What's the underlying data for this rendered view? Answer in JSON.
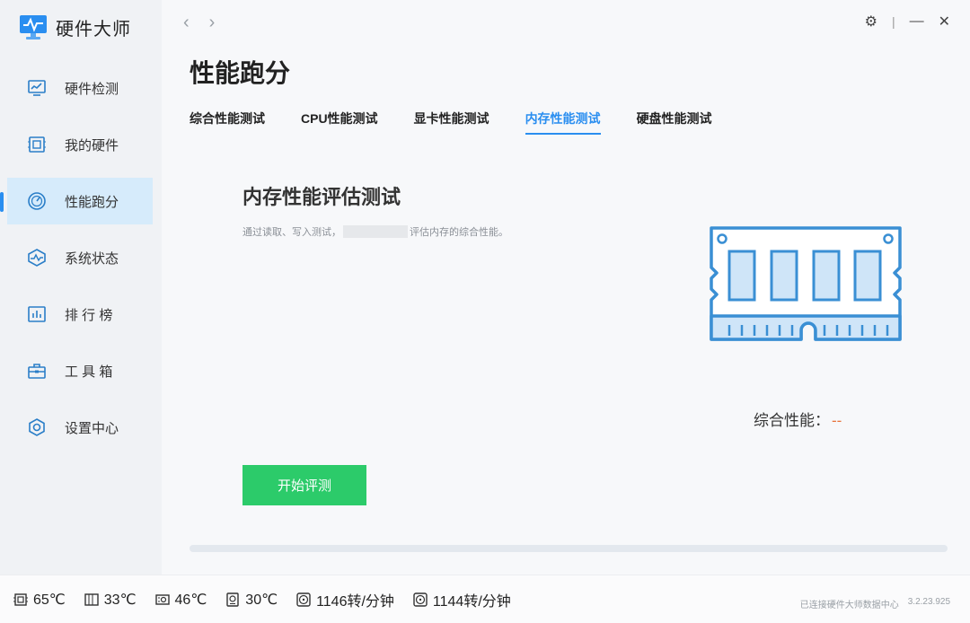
{
  "app": {
    "name": "硬件大师"
  },
  "sidebar": {
    "items": [
      {
        "label": "硬件检测",
        "icon": "monitor-chart-icon"
      },
      {
        "label": "我的硬件",
        "icon": "chip-board-icon"
      },
      {
        "label": "性能跑分",
        "icon": "speedometer-icon",
        "active": true
      },
      {
        "label": "系统状态",
        "icon": "pulse-icon"
      },
      {
        "label": "排 行 榜",
        "icon": "bar-ranking-icon"
      },
      {
        "label": "工 具 箱",
        "icon": "toolbox-icon"
      },
      {
        "label": "设置中心",
        "icon": "hex-settings-icon"
      }
    ]
  },
  "topbar": {
    "back": "‹",
    "forward": "›",
    "settings": "⚙",
    "separator": "|",
    "minimize": "—",
    "close": "✕"
  },
  "page": {
    "title": "性能跑分",
    "tabs": [
      {
        "label": "综合性能测试"
      },
      {
        "label": "CPU性能测试"
      },
      {
        "label": "显卡性能测试"
      },
      {
        "label": "内存性能测试",
        "active": true
      },
      {
        "label": "硬盘性能测试"
      }
    ]
  },
  "test": {
    "title": "内存性能评估测试",
    "desc_prefix": "通过读取、写入测试，",
    "desc_suffix": "评估内存的综合性能。",
    "score_label": "综合性能：",
    "score_value": "--",
    "start_label": "开始评测",
    "progress": 0
  },
  "status": {
    "cpu_temp": "65℃",
    "board_temp": "33℃",
    "gpu_temp": "46℃",
    "disk_temp": "30℃",
    "fan1": "1146转/分钟",
    "fan2": "1144转/分钟",
    "connection": "已连接硬件大师数据中心",
    "version": "3.2.23.925"
  },
  "colors": {
    "accent": "#2a8ef0",
    "start_button": "#2ccb6a",
    "score_value": "#e8743b",
    "active_nav_bg": "#d6ebfb"
  }
}
